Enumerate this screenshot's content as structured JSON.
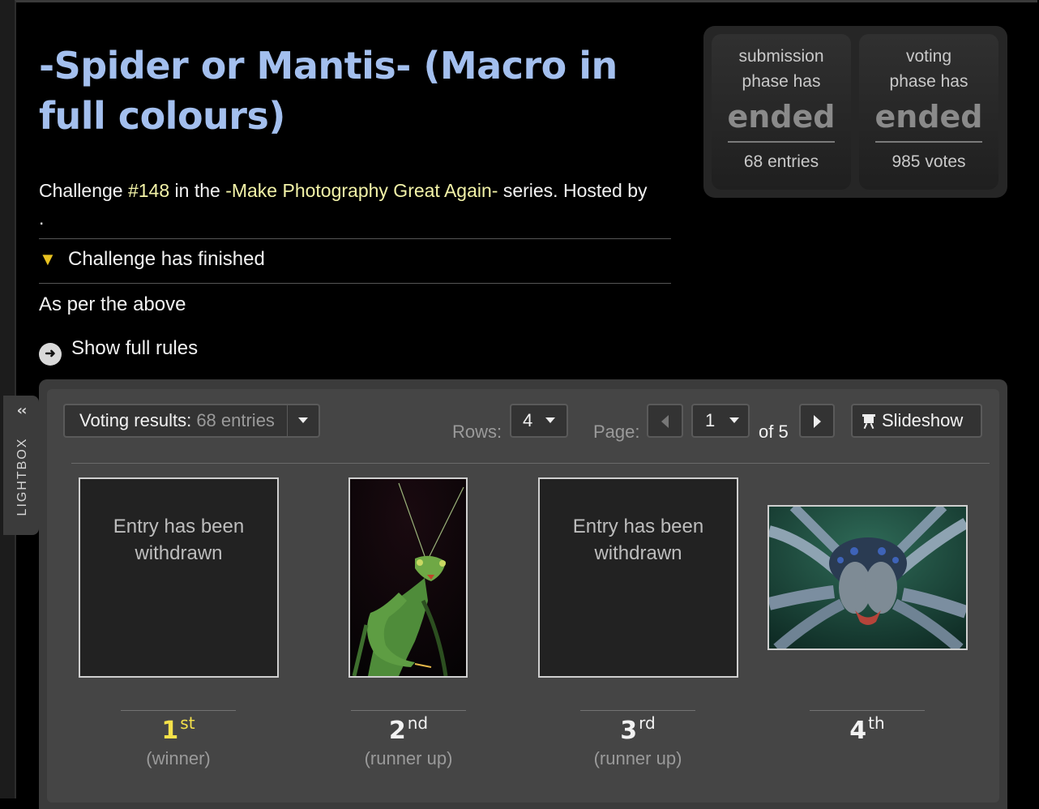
{
  "lightbox": {
    "label": "LIGHTBOX",
    "collapse_icon": "chevron-double-left-icon"
  },
  "challenge": {
    "title": "-Spider or Mantis- (Macro in full colours)",
    "intro_prefix": "Challenge ",
    "number": "#148",
    "intro_mid": " in the ",
    "series": "-Make Photography Great Again-",
    "intro_suffix": " series. Hosted by",
    "host_trailing": ".",
    "status": "Challenge has finished",
    "description": "As per the above",
    "rules_link": "Show full rules"
  },
  "phases": [
    {
      "label": "submission phase has",
      "state": "ended",
      "count": "68 entries"
    },
    {
      "label": "voting phase has",
      "state": "ended",
      "count": "985 votes"
    }
  ],
  "toolbar": {
    "results_label": "Voting results:",
    "results_count": "68 entries",
    "rows_label": "Rows:",
    "rows_value": "4",
    "page_label": "Page:",
    "page_value": "1",
    "page_total": "of 5",
    "slideshow_label": "Slideshow"
  },
  "entries": [
    {
      "rank": "1",
      "suffix": "st",
      "sub": "(winner)",
      "withdrawn": "Entry has been withdrawn",
      "color": "#f5e14a"
    },
    {
      "rank": "2",
      "suffix": "nd",
      "sub": "(runner up)",
      "image": "mantis-photo"
    },
    {
      "rank": "3",
      "suffix": "rd",
      "sub": "(runner up)",
      "withdrawn": "Entry has been withdrawn"
    },
    {
      "rank": "4",
      "suffix": "th",
      "sub": "",
      "image": "spider-photo"
    }
  ],
  "colors": {
    "title": "#a3bfee",
    "highlight": "#f3f3a8",
    "winner": "#f5e14a"
  }
}
